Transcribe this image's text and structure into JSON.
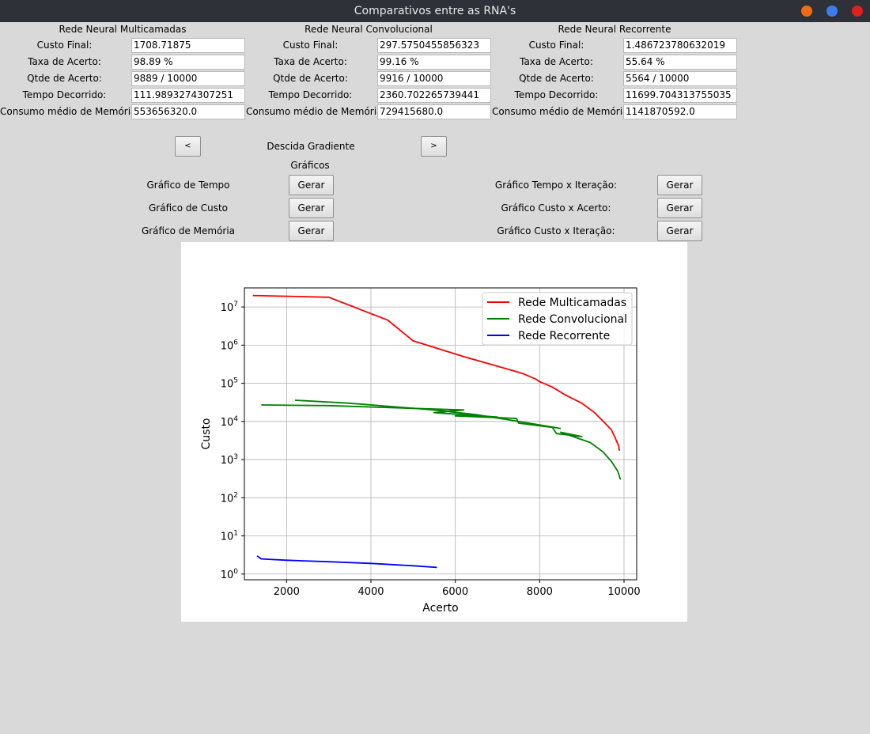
{
  "window": {
    "title": "Comparativos entre as RNA's",
    "buttons": [
      {
        "name": "minimize",
        "color": "#f46a14"
      },
      {
        "name": "maximize",
        "color": "#3b7ded"
      },
      {
        "name": "close",
        "color": "#e0201a"
      }
    ]
  },
  "stat_labels": {
    "custo": "Custo Final:",
    "taxa": "Taxa de Acerto:",
    "qtde": "Qtde de Acerto:",
    "tempo": "Tempo Decorrido:",
    "memoria": "Consumo médio de Memória"
  },
  "networks": [
    {
      "title": "Rede Neural Multicamadas",
      "custo": "1708.71875",
      "taxa": "98.89 %",
      "qtde": "9889 / 10000",
      "tempo": "111.9893274307251",
      "memoria": "553656320.0"
    },
    {
      "title": "Rede Neural Convolucional",
      "custo": "297.5750455856323",
      "taxa": "99.16 %",
      "qtde": "9916 / 10000",
      "tempo": "2360.702265739441",
      "memoria": "729415680.0"
    },
    {
      "title": "Rede Neural Recorrente",
      "custo": "1.486723780632019",
      "taxa": "55.64 %",
      "qtde": "5564 / 10000",
      "tempo": "11699.704313755035",
      "memoria": "1141870592.0"
    }
  ],
  "nav": {
    "prev": "<",
    "next": ">",
    "label": "Descida Gradiente"
  },
  "graphs": {
    "section_label": "Gráficos",
    "button_label": "Gerar",
    "left": [
      "Gráfico de Tempo",
      "Gráfico de Custo",
      "Gráfico de Memória"
    ],
    "right": [
      "Gráfico Tempo x Iteração:",
      "Gráfico Custo x Acerto:",
      "Gráfico Custo x Iteração:"
    ]
  },
  "chart_data": {
    "type": "line",
    "title": "",
    "xlabel": "Acerto",
    "ylabel": "Custo",
    "xlim": [
      1000,
      10300
    ],
    "ylim_log10": [
      -0.15,
      7.5
    ],
    "yscale": "log",
    "grid": true,
    "legend": "top-right",
    "x_ticks": [
      2000,
      4000,
      6000,
      8000,
      10000
    ],
    "y_ticks": [
      {
        "base": "10",
        "exp": "0"
      },
      {
        "base": "10",
        "exp": "1"
      },
      {
        "base": "10",
        "exp": "2"
      },
      {
        "base": "10",
        "exp": "3"
      },
      {
        "base": "10",
        "exp": "4"
      },
      {
        "base": "10",
        "exp": "5"
      },
      {
        "base": "10",
        "exp": "6"
      },
      {
        "base": "10",
        "exp": "7"
      }
    ],
    "series": [
      {
        "name": "Rede Multicamadas",
        "color": "#ff0000",
        "x": [
          1200,
          3000,
          4400,
          5000,
          6200,
          7000,
          7600,
          7900,
          8000,
          8300,
          8600,
          9000,
          9300,
          9550,
          9700,
          9800,
          9870,
          9889
        ],
        "y": [
          20000000,
          18000000,
          4500000,
          1300000,
          500000,
          280000,
          180000,
          130000,
          110000,
          80000,
          50000,
          30000,
          17000,
          9000,
          6000,
          3500,
          2300,
          1709
        ]
      },
      {
        "name": "Rede Convolucional",
        "color": "#008000",
        "x": [
          1400,
          3000,
          5000,
          6200,
          5500,
          7000,
          6000,
          7450,
          7500,
          8300,
          8400,
          9000,
          8500,
          9200,
          9500,
          9700,
          9850,
          9916
        ],
        "y": [
          27000,
          26000,
          22000,
          20000,
          17000,
          13000,
          14000,
          12000,
          9000,
          7000,
          4800,
          4000,
          5200,
          2800,
          1600,
          900,
          500,
          297.6
        ],
        "x2": [
          2200,
          3500,
          5500,
          6500,
          7500,
          8500
        ],
        "y2": [
          36000,
          30000,
          20000,
          15000,
          10000,
          6500
        ]
      },
      {
        "name": "Rede Recorrente",
        "color": "#0000ff",
        "x": [
          1300,
          1400,
          2000,
          3000,
          4000,
          5000,
          5564
        ],
        "y": [
          3.0,
          2.5,
          2.3,
          2.1,
          1.9,
          1.65,
          1.49
        ]
      }
    ]
  }
}
